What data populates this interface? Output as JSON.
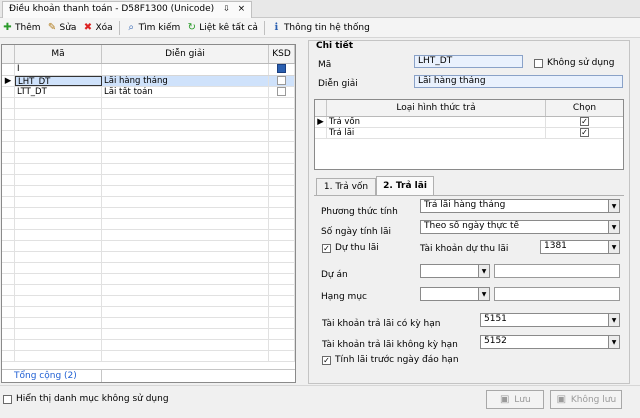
{
  "title_tab": {
    "label": "Điều khoản thanh toán - D58F1300 (Unicode)",
    "pin": "⇩",
    "close": "×"
  },
  "toolbar": {
    "add": "Thêm",
    "edit": "Sửa",
    "delete": "Xóa",
    "search": "Tìm kiếm",
    "list_all": "Liệt kê tất cả",
    "system_info": "Thông tin hệ thống"
  },
  "grid": {
    "headers": {
      "code": "Mã",
      "description": "Diễn giải",
      "ksd": "KSD"
    },
    "filter_code": "I",
    "rows": [
      {
        "code": "LHT_DT",
        "description": "Lãi hàng tháng"
      },
      {
        "code": "LTT_DT",
        "description": "Lãi tất toán"
      }
    ],
    "total": "Tổng cộng (2)"
  },
  "detail": {
    "group_title": "Chi tiết",
    "code_label": "Mã",
    "code_value": "LHT_DT",
    "inactive_label": "Không sử dụng",
    "desc_label": "Diễn giải",
    "desc_value": "Lãi hàng tháng"
  },
  "payment_types": {
    "headers": {
      "type": "Loại hình thức trả",
      "choose": "Chọn"
    },
    "rows": [
      {
        "type": "Trả vốn",
        "checked": "✓"
      },
      {
        "type": "Trả lãi",
        "checked": "✓"
      }
    ]
  },
  "tabs": {
    "principal": "1. Trả vốn",
    "interest": "2. Trả lãi"
  },
  "interest": {
    "method_label": "Phương thức tính",
    "method_value": "Trả lãi hàng tháng",
    "days_label": "Số ngày tính lãi",
    "days_value": "Theo số ngày thực tế",
    "accrual_label": "Dự thu lãi",
    "accrual_checked": "✓",
    "accrual_account_label": "Tài khoản dự thu lãi",
    "accrual_account_value": "1381",
    "project_label": "Dự án",
    "project_value": "",
    "item_label": "Hạng mục",
    "item_value": "",
    "term_account_label": "Tài khoản trả lãi có kỳ hạn",
    "term_account_value": "5151",
    "noterm_account_label": "Tài khoản trả lãi không  kỳ hạn",
    "noterm_account_value": "5152",
    "pre_maturity_label": "Tính lãi trước ngày đáo hạn",
    "pre_maturity_checked": "✓"
  },
  "footer": {
    "show_inactive_label": "Hiển thị danh mục không sử dụng",
    "save": "Lưu",
    "nosave": "Không lưu"
  }
}
